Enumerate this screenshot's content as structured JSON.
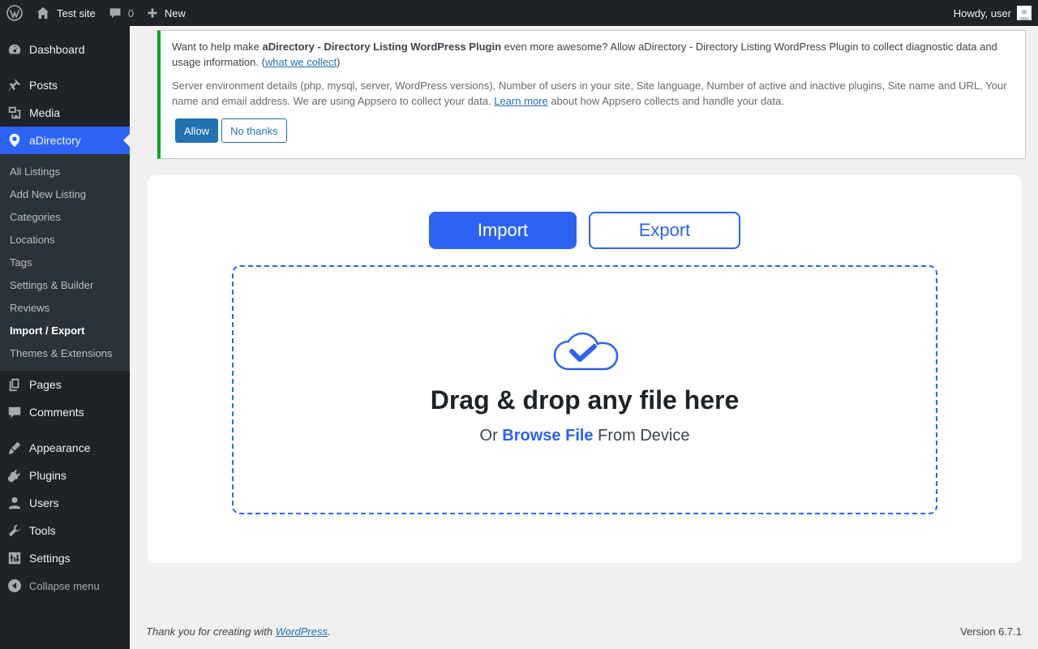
{
  "adminbar": {
    "site_name": "Test site",
    "comments_count": "0",
    "new_label": "New",
    "howdy": "Howdy, user"
  },
  "sidebar": {
    "items": [
      {
        "label": "Dashboard",
        "icon": "dashboard-icon"
      },
      {
        "label": "Posts",
        "icon": "pin-icon"
      },
      {
        "label": "Media",
        "icon": "media-icon"
      },
      {
        "label": "aDirectory",
        "icon": "location-pin-icon"
      },
      {
        "label": "Pages",
        "icon": "pages-icon"
      },
      {
        "label": "Comments",
        "icon": "comment-icon"
      },
      {
        "label": "Appearance",
        "icon": "paintbrush-icon"
      },
      {
        "label": "Plugins",
        "icon": "plugin-icon"
      },
      {
        "label": "Users",
        "icon": "user-icon"
      },
      {
        "label": "Tools",
        "icon": "wrench-icon"
      },
      {
        "label": "Settings",
        "icon": "settings-sliders-icon"
      }
    ],
    "submenu": [
      "All Listings",
      "Add New Listing",
      "Categories",
      "Locations",
      "Tags",
      "Settings & Builder",
      "Reviews",
      "Import / Export",
      "Themes & Extensions"
    ],
    "collapse_label": "Collapse menu"
  },
  "notice": {
    "p1_a": "Want to help make ",
    "p1_strong": "aDirectory - Directory Listing WordPress Plugin",
    "p1_b": " even more awesome? Allow aDirectory - Directory Listing WordPress Plugin to collect diagnostic data and usage information. (",
    "p1_link": "what we collect",
    "p1_c": ")",
    "p2_a": "Server environment details (php, mysql, server, WordPress versions), Number of users in your site, Site language, Number of active and inactive plugins, Site name and URL, Your name and email address. We are using Appsero to collect your data. ",
    "p2_link": "Learn more",
    "p2_b": " about how Appsero collects and handle your data.",
    "allow_label": "Allow",
    "no_label": "No thanks"
  },
  "main": {
    "tab_import": "Import",
    "tab_export": "Export",
    "drop_title": "Drag & drop any file here",
    "drop_or": "Or ",
    "drop_browse": "Browse File",
    "drop_from": " From Device"
  },
  "footer": {
    "thanks": "Thank you for creating with ",
    "wp_link": "WordPress",
    "period": ".",
    "version": "Version 6.7.1"
  },
  "colors": {
    "accent": "#2c63f5",
    "wp_blue": "#2271b1",
    "notice_border": "#00a32a",
    "sidebar_bg": "#1d2327"
  }
}
